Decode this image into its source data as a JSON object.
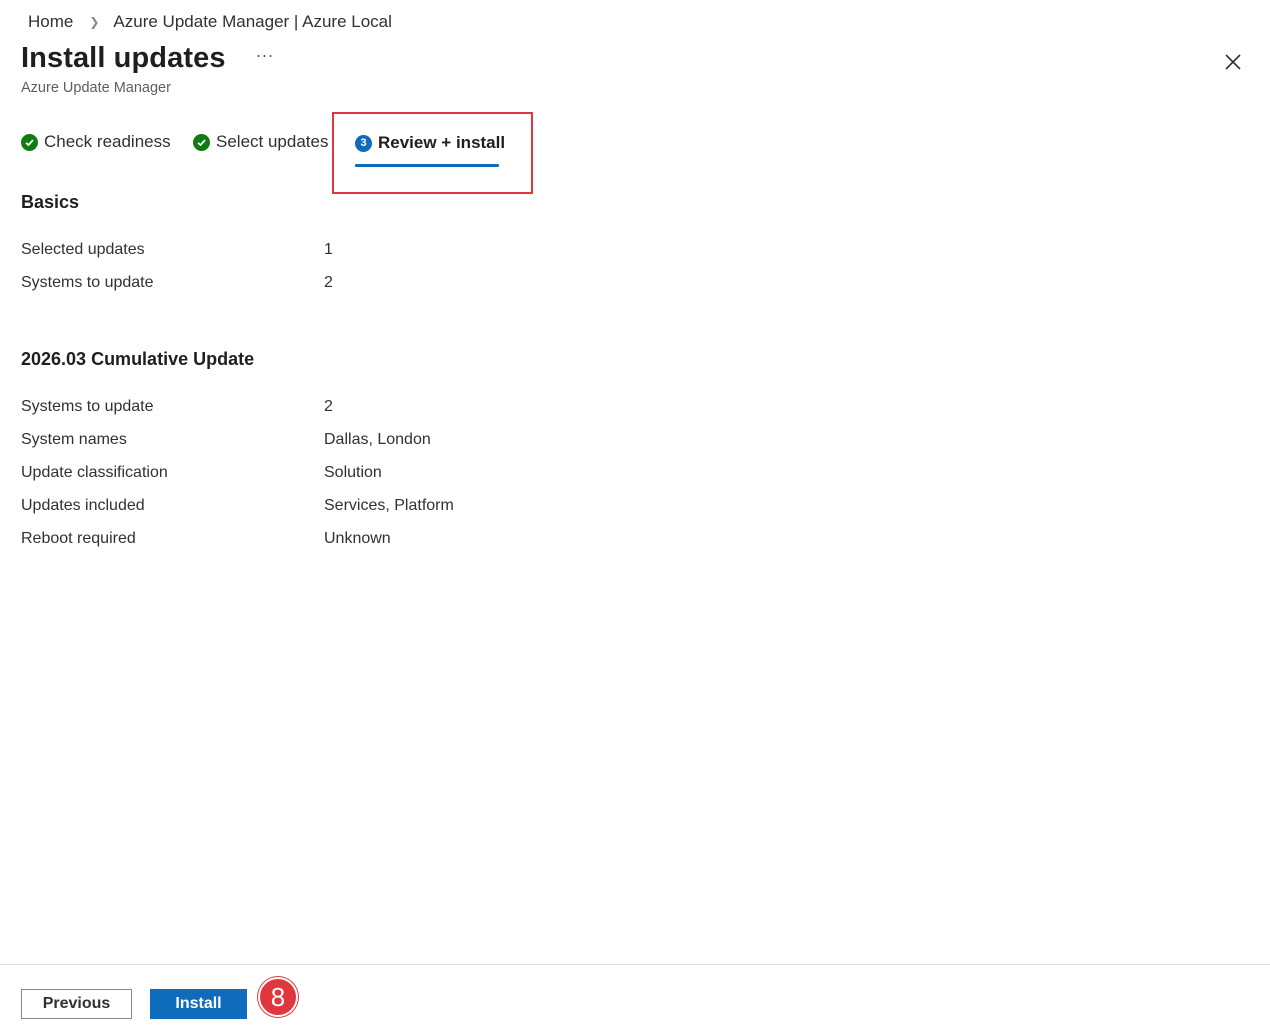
{
  "breadcrumb": {
    "home": "Home",
    "current": "Azure Update Manager | Azure Local"
  },
  "header": {
    "title": "Install updates",
    "more": "···",
    "subtitle": "Azure Update Manager"
  },
  "steps": [
    {
      "label": "Check readiness",
      "state": "complete"
    },
    {
      "label": "Select updates",
      "state": "complete"
    },
    {
      "label": "Review + install",
      "state": "active",
      "number": "3"
    }
  ],
  "basics": {
    "title": "Basics",
    "rows": [
      {
        "label": "Selected updates",
        "value": "1"
      },
      {
        "label": "Systems to update",
        "value": "2"
      }
    ]
  },
  "update": {
    "title": "2026.03 Cumulative Update",
    "rows": [
      {
        "label": "Systems to update",
        "value": "2"
      },
      {
        "label": "System names",
        "value": "Dallas, London"
      },
      {
        "label": "Update classification",
        "value": "Solution"
      },
      {
        "label": "Updates included",
        "value": "Services, Platform"
      },
      {
        "label": "Reboot required",
        "value": "Unknown"
      }
    ]
  },
  "footer": {
    "previous_label": "Previous",
    "install_label": "Install"
  },
  "annotation": {
    "callout": "8"
  },
  "colors": {
    "accent": "#0f6cbd",
    "success": "#107c10",
    "highlight": "#e0373f"
  }
}
